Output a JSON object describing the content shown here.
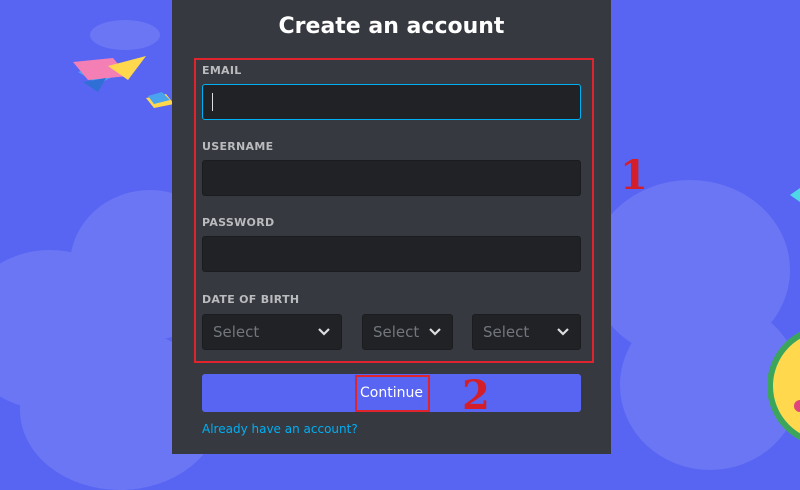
{
  "form": {
    "title": "Create an account",
    "email_label": "EMAIL",
    "email_value": "",
    "username_label": "USERNAME",
    "username_value": "",
    "password_label": "PASSWORD",
    "password_value": "",
    "dob_label": "DATE OF BIRTH",
    "dob_selects": [
      {
        "placeholder": "Select"
      },
      {
        "placeholder": "Select"
      },
      {
        "placeholder": "Select"
      }
    ],
    "continue_label": "Continue",
    "login_link": "Already have an account?"
  },
  "annotations": {
    "step1": "1",
    "step2": "2"
  },
  "colors": {
    "background": "#5865f2",
    "modal": "#36393f",
    "input": "#202225",
    "focus": "#00b0f4",
    "button": "#5865f2",
    "annotation": "#e0242e"
  }
}
